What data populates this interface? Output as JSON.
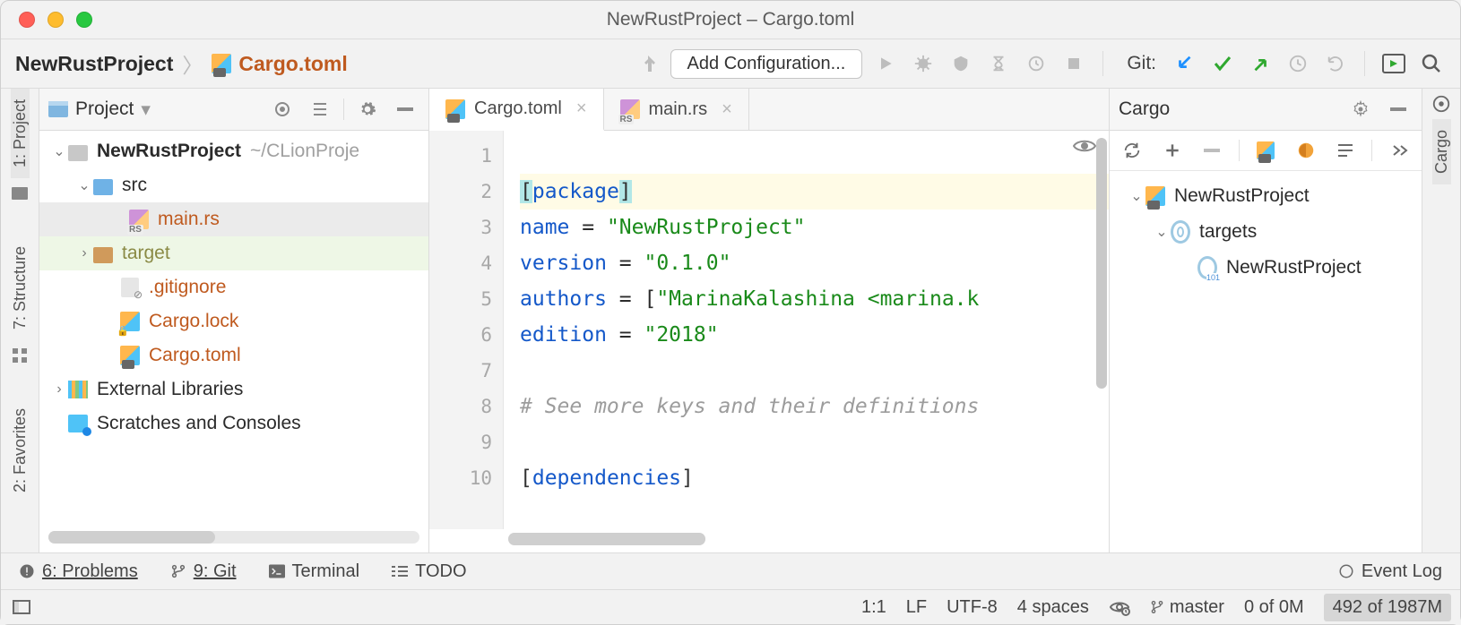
{
  "window": {
    "title": "NewRustProject – Cargo.toml"
  },
  "breadcrumbs": {
    "root": "NewRustProject",
    "file": "Cargo.toml"
  },
  "toolbar": {
    "add_configuration": "Add Configuration...",
    "git_label": "Git:"
  },
  "left_tool_tabs": {
    "project": "1: Project",
    "structure": "7: Structure",
    "favorites": "2: Favorites"
  },
  "right_tool_tabs": {
    "cargo": "Cargo"
  },
  "project_panel": {
    "title": "Project",
    "tree": {
      "root": "NewRustProject",
      "root_hint": "~/CLionProje",
      "src": "src",
      "main_rs": "main.rs",
      "target": "target",
      "gitignore": ".gitignore",
      "cargo_lock": "Cargo.lock",
      "cargo_toml": "Cargo.toml",
      "ext_lib": "External Libraries",
      "scratches": "Scratches and Consoles"
    }
  },
  "editor_tabs": {
    "tab1": "Cargo.toml",
    "tab2": "main.rs"
  },
  "editor": {
    "lines": {
      "l1a": "[",
      "l1b": "package",
      "l1c": "]",
      "l2a": "name",
      "l2b": " = ",
      "l2c": "\"NewRustProject\"",
      "l3a": "version",
      "l3b": " = ",
      "l3c": "\"0.1.0\"",
      "l4a": "authors",
      "l4b": " = [",
      "l4c": "\"MarinaKalashina <marina.k",
      "l5a": "edition",
      "l5b": " = ",
      "l5c": "\"2018\"",
      "l7": "# See more keys and their definitions",
      "l9a": "[",
      "l9b": "dependencies",
      "l9c": "]"
    },
    "gutter": [
      "1",
      "2",
      "3",
      "4",
      "5",
      "6",
      "7",
      "8",
      "9",
      "10"
    ]
  },
  "cargo_panel": {
    "title": "Cargo",
    "root": "NewRustProject",
    "targets": "targets",
    "bin": "NewRustProject"
  },
  "bottom_tools": {
    "problems": "6: Problems",
    "git": "9: Git",
    "terminal": "Terminal",
    "todo": "TODO",
    "event_log": "Event Log"
  },
  "status": {
    "caret": "1:1",
    "line_sep": "LF",
    "encoding": "UTF-8",
    "indent": "4 spaces",
    "branch": "master",
    "tasks": "0 of 0M",
    "memory": "492 of 1987M"
  }
}
